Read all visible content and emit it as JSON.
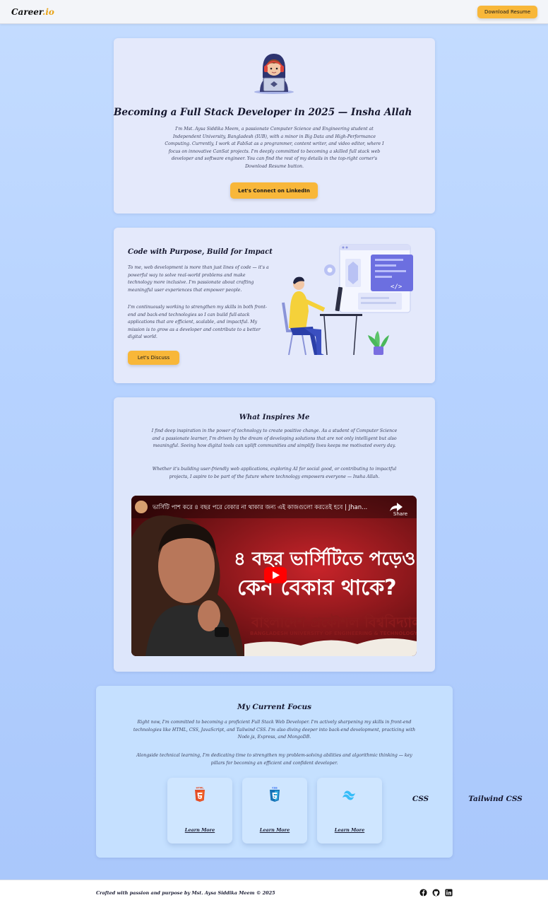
{
  "nav": {
    "logo_main": "Career",
    "logo_suffix": ".io",
    "download_label": "Download Resume"
  },
  "hero": {
    "title": "Becoming a Full Stack Developer in 2025 — Insha Allah",
    "description": "I'm Mst. Aysa Siddika Meem, a passionate Computer Science and Engineering student at Independent University, Bangladesh (IUB), with a minor in Big Data and High-Performance Computing. Currently, I work at FabSat as a programmer, content writer, and video editor, where I focus on innovative CanSat projects. I'm deeply committed to becoming a skilled full stack web developer and software engineer. You can find the rest of my details in the top-right corner's Download Resume button.",
    "cta_label": "Let's Connect on LinkedIn"
  },
  "purpose": {
    "title": "Code with Purpose, Build for Impact",
    "para1": "To me, web development is more than just lines of code — it's a powerful way to solve real-world problems and make technology more inclusive. I'm passionate about crafting meaningful user experiences that empower people.",
    "para2": "I'm continuously working to strengthen my skills in both front-end and back-end technologies so I can build full-stack applications that are efficient, scalable, and impactful. My mission is to grow as a developer and contribute to a better digital world.",
    "button_label": "Let's Discuss"
  },
  "inspire": {
    "title": "What Inspires Me",
    "para1": "I find deep inspiration in the power of technology to create positive change. As a student of Computer Science and a passionate learner, I'm driven by the dream of developing solutions that are not only intelligent but also meaningful. Seeing how digital tools can uplift communities and simplify lives keeps me motivated every day.",
    "para2": "Whether it's building user-friendly web applications, exploring AI for social good, or contributing to impactful projects, I aspire to be part of the future where technology empowers everyone — Insha Allah.",
    "video": {
      "title": "ভার্সিটি পাশ করে ৪ বছর পরে বেকার না থাকার জন্য এই কাজগুলো করতেই হবে | Jhan...",
      "share_label": "Share",
      "thumb_line1": "৪ বছর ভার্সিটিতে পড়েও",
      "thumb_line2": "কেন বেকার থাকে?",
      "bg_sign_line1": "বাংলাদেশ প্রকৌশল বিশ্ববিদ্যালয়",
      "bg_sign_line2": "BANGLADESH UNIVERSITY OF ENGINEERING & TECHNOLOGY"
    }
  },
  "focus": {
    "title": "My Current Focus",
    "para1": "Right now, I'm committed to becoming a proficient Full Stack Web Developer. I'm actively sharpening my skills in front-end technologies like HTML, CSS, JavaScript, and Tailwind CSS. I'm also diving deeper into back-end development, practicing with Node.js, Express, and MongoDB.",
    "para2": "Alongside technical learning, I'm dedicating time to strengthen my problem-solving abilities and algorithmic thinking — key pillars for becoming an efficient and confident developer.",
    "cards": [
      {
        "name": "HTML",
        "badge": "HTML",
        "link": "Learn More",
        "icon": "html5-icon",
        "color": "#e44d26"
      },
      {
        "name": "CSS",
        "badge": "CSS",
        "link": "Learn More",
        "icon": "css3-icon",
        "color": "#2965f1"
      },
      {
        "name": "Tailwind CSS",
        "link": "Learn More",
        "icon": "tailwind-icon",
        "color": "#38bdf8"
      }
    ]
  },
  "footer": {
    "credit": "Crafted with passion and purpose by Mst. Aysa Siddika Meem © 2025",
    "icons": [
      "facebook-icon",
      "github-icon",
      "linkedin-icon"
    ]
  },
  "colors": {
    "accent": "#f8b739",
    "card": "#e4e9fb",
    "background": "#b7d3ff"
  }
}
